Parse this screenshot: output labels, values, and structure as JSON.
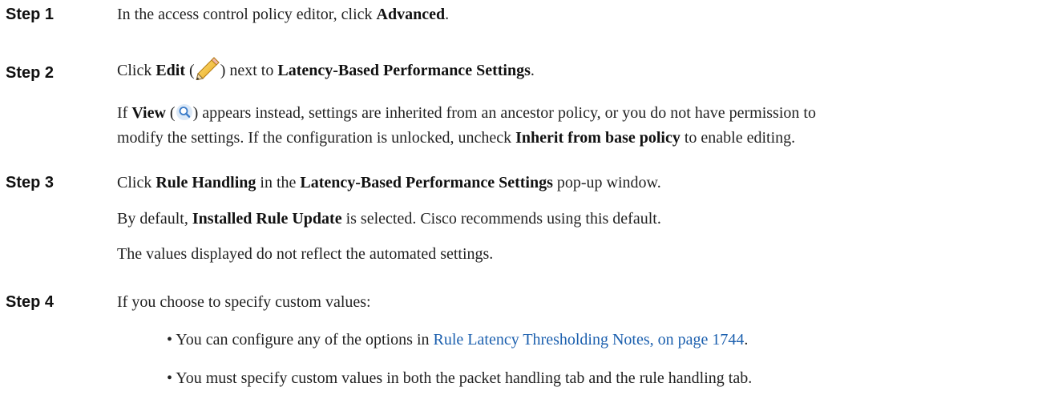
{
  "step1": {
    "label": "Step 1",
    "text_before": "In the access control policy editor, click ",
    "bold": "Advanced",
    "text_after": "."
  },
  "step2": {
    "label": "Step 2",
    "t1": "Click ",
    "edit": "Edit",
    "t2": " (",
    "edit_icon": "pencil-icon",
    "t3": ") next to ",
    "settings_bold": "Latency-Based Performance Settings",
    "t4": ".",
    "p_view": "View",
    "p_t1": "If ",
    "p_t2": " (",
    "view_icon": "magnifier-icon",
    "p_t3": ") appears instead, settings are inherited from an ancestor policy, or you do not have permission to",
    "p_line2_a": "modify the settings. If the configuration is unlocked, uncheck ",
    "p_line2_bold": "Inherit from base policy",
    "p_line2_b": " to enable editing."
  },
  "step3": {
    "label": "Step 3",
    "t1": "Click ",
    "rule_bold": "Rule Handling",
    "t2": " in the ",
    "settings_bold": "Latency-Based Performance Settings",
    "t3": " pop-up window.",
    "p1_a": "By default, ",
    "p1_bold": "Installed Rule Update",
    "p1_b": " is selected. Cisco recommends using this default.",
    "p2": "The values displayed do not reflect the automated settings."
  },
  "step4": {
    "label": "Step 4",
    "text": "If you choose to specify custom values:",
    "bullet1_a": "• You can configure any of the options in ",
    "bullet1_link": "Rule Latency Thresholding Notes, on page 1744",
    "bullet1_b": ".",
    "bullet2": "• You must specify custom values in both the packet handling tab and the rule handling tab."
  },
  "colors": {
    "link": "#1b5fae",
    "text": "#222222"
  }
}
